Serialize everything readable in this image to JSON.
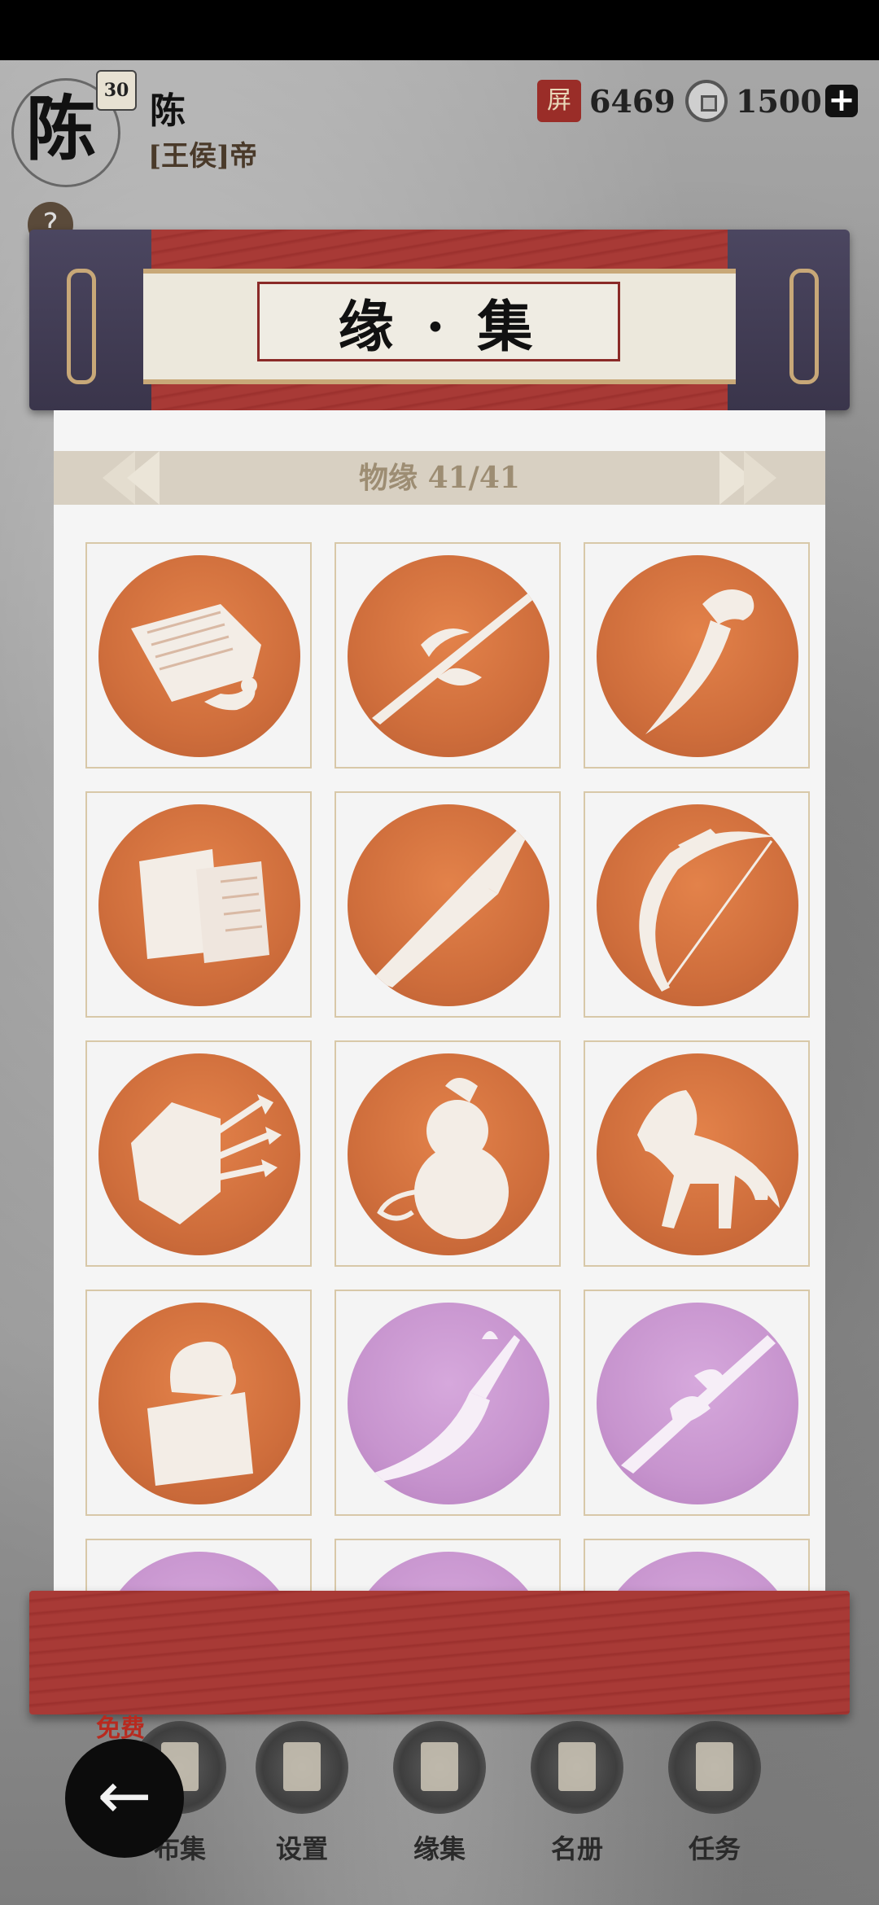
{
  "player": {
    "avatar_char": "陈",
    "level": "30",
    "name": "陈",
    "title": "[王侯]帝"
  },
  "resources": {
    "gold_icon": "屏",
    "gold": "6469",
    "coin": "1500"
  },
  "scroll": {
    "title": "缘 · 集"
  },
  "category": {
    "label": "物缘 41/41"
  },
  "items": [
    {
      "name": "scroll-book",
      "color": "orange"
    },
    {
      "name": "halberd",
      "color": "orange"
    },
    {
      "name": "curved-blade",
      "color": "orange"
    },
    {
      "name": "letter-scroll",
      "color": "orange"
    },
    {
      "name": "broad-sword",
      "color": "orange"
    },
    {
      "name": "bow",
      "color": "orange"
    },
    {
      "name": "shield-with-arrows",
      "color": "orange"
    },
    {
      "name": "gourd",
      "color": "orange"
    },
    {
      "name": "horse",
      "color": "orange"
    },
    {
      "name": "seal",
      "color": "orange"
    },
    {
      "name": "guandao",
      "color": "purple"
    },
    {
      "name": "dragon-spear",
      "color": "purple"
    }
  ],
  "colors": {
    "orange": "#cf6e3c",
    "purple": "#c794ce",
    "scroll_red": "#a83a36",
    "scroll_ends": "#3a354b"
  },
  "nav": {
    "free_badge": "免费",
    "items": [
      {
        "label": "布集",
        "icon": "coin-pouch-icon"
      },
      {
        "label": "设置",
        "icon": "settings-icon"
      },
      {
        "label": "缘集",
        "icon": "collection-book-icon"
      },
      {
        "label": "名册",
        "icon": "roster-book-icon"
      },
      {
        "label": "任务",
        "icon": "task-scroll-icon"
      }
    ],
    "back": "←",
    "plus": "+",
    "help": "?"
  }
}
